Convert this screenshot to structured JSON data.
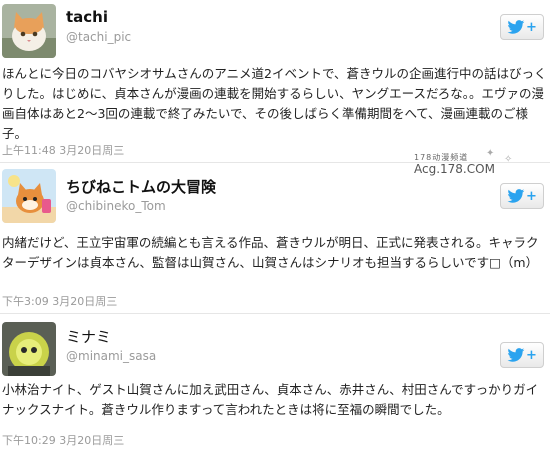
{
  "tweets": [
    {
      "name": "tachi",
      "handle": "@tachi_pic",
      "text": "ほんとに今日のコバヤシオサムさんのアニメ道2イベントで、蒼きウルの企画進行中の話はびっくりした。はじめに、貞本さんが漫画の連載を開始するらしい、ヤングエースだろな。。エヴァの漫画自体はあと2～3回の連載で終了みたいで、その後しばらく準備期間をへて、漫画連載のご様子。",
      "time": "上午11:48 3月20日周三",
      "avatar_icon": "cat-photo-avatar"
    },
    {
      "name": "ちびねこトムの大冒険",
      "handle": "@chibineko_Tom",
      "text": "内緒だけど、王立宇宙軍の続編とも言える作品、蒼きウルが明日、正式に発表される。キャラクターデザインは貞本さん、監督は山賀さん、山賀さんはシナリオも担当するらしいです□（m）",
      "time": "下午3:09 3月20日周三",
      "avatar_icon": "cartoon-cat-avatar"
    },
    {
      "name": "ミナミ",
      "handle": "@minami_sasa",
      "text": "小林治ナイト、ゲスト山賀さんに加え武田さん、貞本さん、赤井さん、村田さんですっかりガイナックスナイト。蒼きウル作りますって言われたときは将に至福の瞬間でした。",
      "time": "下午10:29 3月20日周三",
      "avatar_icon": "figure-photo-avatar"
    }
  ],
  "follow_button": {
    "plus": "+",
    "icon": "twitter-bird-icon",
    "color": "#2aa3ef"
  },
  "watermark": {
    "line1": "178动漫频道",
    "line2": "Acg.178.COM"
  }
}
